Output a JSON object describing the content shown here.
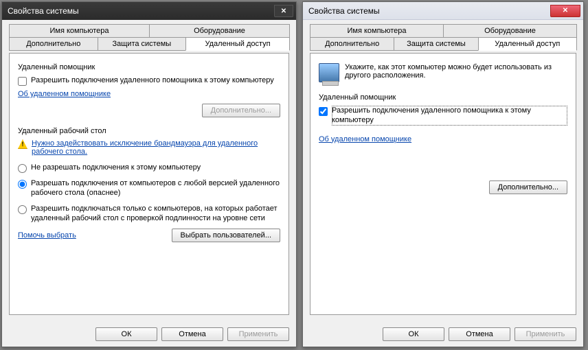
{
  "left": {
    "title": "Свойства системы",
    "tabs_row1": [
      "Имя компьютера",
      "Оборудование"
    ],
    "tabs_row2": [
      "Дополнительно",
      "Защита системы",
      "Удаленный доступ"
    ],
    "active_tab": "Удаленный доступ",
    "assist": {
      "title": "Удаленный помощник",
      "checkbox": "Разрешить подключения удаленного помощника к этому компьютеру",
      "checked": false,
      "link": "Об удаленном помощнике",
      "advanced_btn": "Дополнительно...",
      "advanced_disabled": true
    },
    "rdp": {
      "title": "Удаленный рабочий стол",
      "warn": "Нужно задействовать исключение брандмауэра для удаленного рабочего стола.",
      "radio1": "Не разрешать подключения к этому компьютеру",
      "radio2": "Разрешать подключения от компьютеров с любой версией удаленного рабочего стола (опаснее)",
      "radio3": "Разрешить подключаться только с компьютеров, на которых работает удаленный рабочий стол с проверкой подлинности на уровне сети",
      "selected": 2,
      "help_link": "Помочь выбрать",
      "select_users_btn": "Выбрать пользователей..."
    },
    "buttons": {
      "ok": "ОК",
      "cancel": "Отмена",
      "apply": "Применить"
    }
  },
  "right": {
    "title": "Свойства системы",
    "tabs_row1": [
      "Имя компьютера",
      "Оборудование"
    ],
    "tabs_row2": [
      "Дополнительно",
      "Защита системы",
      "Удаленный доступ"
    ],
    "active_tab": "Удаленный доступ",
    "info_text": "Укажите, как этот компьютер можно будет использовать из другого расположения.",
    "assist": {
      "title": "Удаленный помощник",
      "checkbox": "Разрешить подключения удаленного помощника к этому компьютеру",
      "checked": true,
      "link": "Об удаленном помощнике",
      "advanced_btn": "Дополнительно...",
      "advanced_disabled": false
    },
    "buttons": {
      "ok": "ОК",
      "cancel": "Отмена",
      "apply": "Применить"
    }
  }
}
